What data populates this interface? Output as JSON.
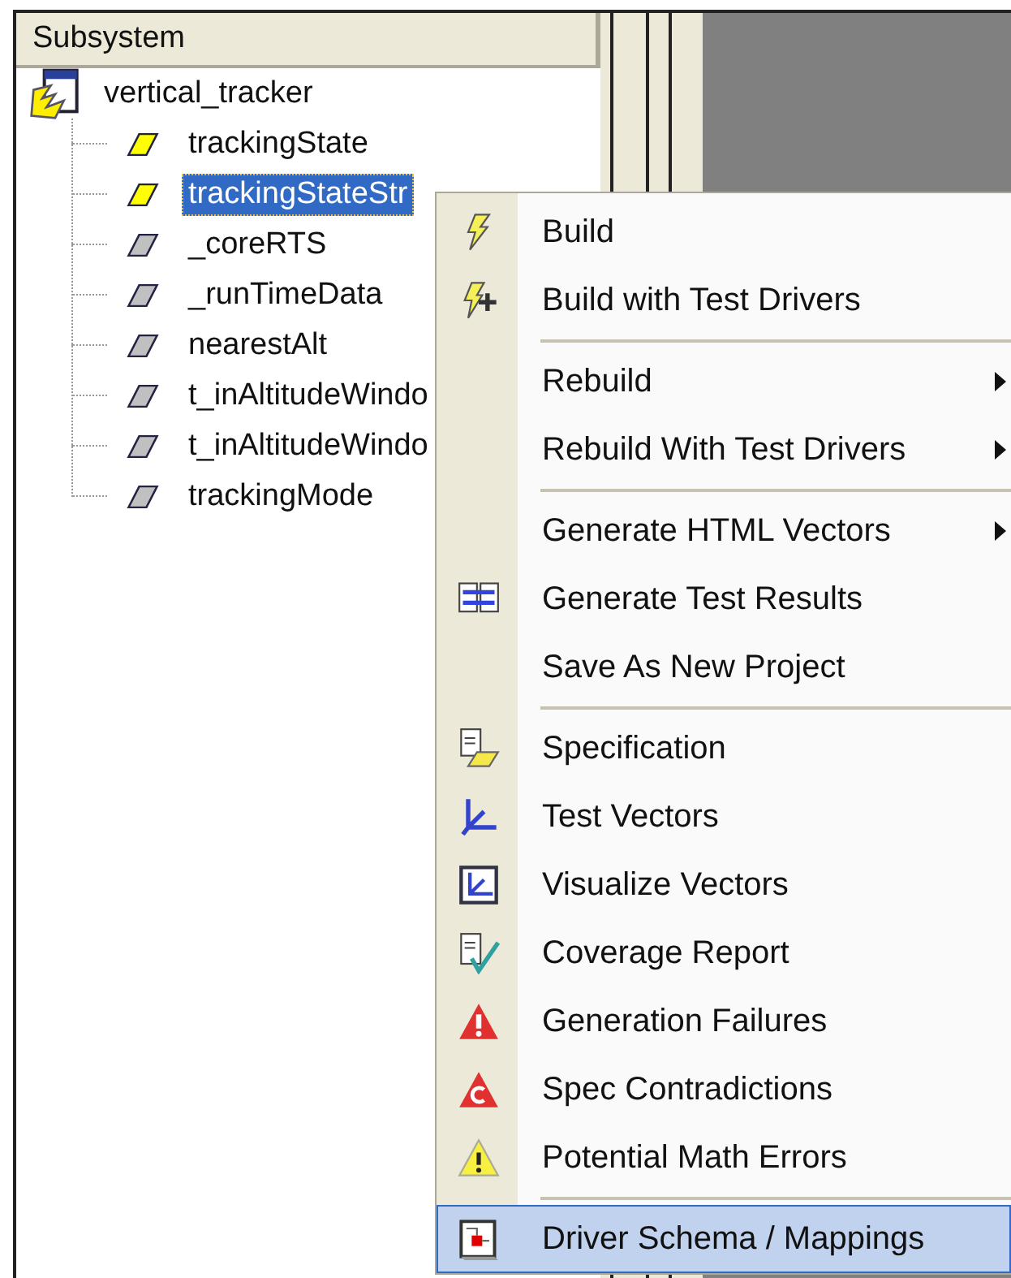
{
  "panel": {
    "header": "Subsystem",
    "tree": {
      "label": "vertical_tracker",
      "children": [
        {
          "label": "trackingState",
          "color": "#ffff00",
          "selected": false
        },
        {
          "label": "trackingStateStr",
          "color": "#ffff00",
          "selected": true
        },
        {
          "label": "_coreRTS",
          "color": "#c0c0c0",
          "selected": false
        },
        {
          "label": "_runTimeData",
          "color": "#c0c0c0",
          "selected": false
        },
        {
          "label": "nearestAlt",
          "color": "#c0c0c0",
          "selected": false
        },
        {
          "label": "t_inAltitudeWindo",
          "color": "#c0c0c0",
          "selected": false
        },
        {
          "label": "t_inAltitudeWindo",
          "color": "#c0c0c0",
          "selected": false
        },
        {
          "label": "trackingMode",
          "color": "#c0c0c0",
          "selected": false
        }
      ]
    }
  },
  "context_menu": {
    "items": [
      {
        "kind": "item",
        "label": "Build",
        "submenu": false,
        "selected": false
      },
      {
        "kind": "item",
        "label": "Build with Test Drivers",
        "submenu": false,
        "selected": false
      },
      {
        "kind": "separator"
      },
      {
        "kind": "item",
        "label": "Rebuild",
        "submenu": true,
        "selected": false
      },
      {
        "kind": "item",
        "label": "Rebuild With Test Drivers",
        "submenu": true,
        "selected": false
      },
      {
        "kind": "separator"
      },
      {
        "kind": "item",
        "label": "Generate HTML Vectors",
        "submenu": true,
        "selected": false
      },
      {
        "kind": "item",
        "label": "Generate Test Results",
        "submenu": false,
        "selected": false
      },
      {
        "kind": "item",
        "label": "Save As New Project",
        "submenu": false,
        "selected": false
      },
      {
        "kind": "separator"
      },
      {
        "kind": "item",
        "label": "Specification",
        "submenu": false,
        "selected": false
      },
      {
        "kind": "item",
        "label": "Test  Vectors",
        "submenu": false,
        "selected": false
      },
      {
        "kind": "item",
        "label": "Visualize Vectors",
        "submenu": false,
        "selected": false
      },
      {
        "kind": "item",
        "label": "Coverage Report",
        "submenu": false,
        "selected": false
      },
      {
        "kind": "item",
        "label": "Generation Failures",
        "submenu": false,
        "selected": false
      },
      {
        "kind": "item",
        "label": "Spec Contradictions",
        "submenu": false,
        "selected": false
      },
      {
        "kind": "item",
        "label": "Potential Math Errors",
        "submenu": false,
        "selected": false
      },
      {
        "kind": "separator"
      },
      {
        "kind": "item",
        "label": "Driver Schema / Mappings",
        "submenu": false,
        "selected": true
      }
    ]
  }
}
